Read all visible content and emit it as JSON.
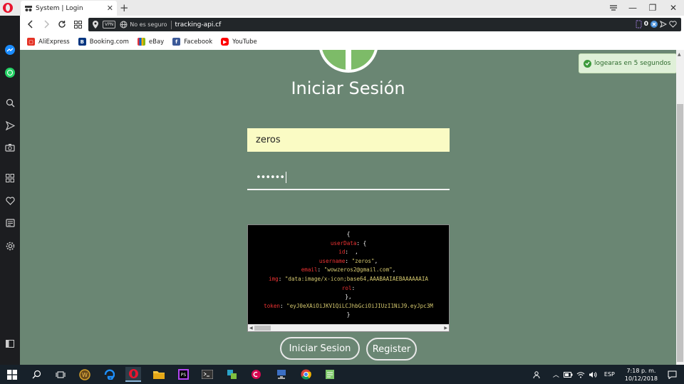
{
  "browser": {
    "tab_title": "System | Login",
    "new_tab": "+",
    "tab_close": "✕",
    "vpn_label": "VPN",
    "security_label": "No es seguro",
    "url": "tracking-api.cf",
    "adblock_count": "0",
    "window_minimize": "—",
    "window_restore": "❐",
    "window_close": "✕"
  },
  "bookmarks": [
    {
      "label": "AliExpress",
      "icon": "aliexpress-icon",
      "color": "#e43225"
    },
    {
      "label": "Booking.com",
      "icon": "booking-icon",
      "color": "#003580"
    },
    {
      "label": "eBay",
      "icon": "ebay-icon",
      "color": "#e53238"
    },
    {
      "label": "Facebook",
      "icon": "facebook-icon",
      "color": "#3b5998"
    },
    {
      "label": "YouTube",
      "icon": "youtube-icon",
      "color": "#ff0000"
    }
  ],
  "sidebar": [
    {
      "icon": "messenger-icon",
      "color": "#1a8cff"
    },
    {
      "icon": "whatsapp-icon",
      "color": "#25d366"
    },
    {
      "icon": "search-icon"
    },
    {
      "icon": "send-icon"
    },
    {
      "icon": "camera-icon"
    },
    {
      "icon": "grid-icon"
    },
    {
      "icon": "heart-icon"
    },
    {
      "icon": "news-icon"
    },
    {
      "icon": "settings-icon"
    },
    {
      "icon": "sidebar-toggle-icon"
    }
  ],
  "page": {
    "title": "Iniciar Sesión",
    "username_value": "zeros",
    "password_mask": "••••••",
    "login_button": "Iniciar Sesion",
    "register_button": "Register",
    "toast_text": "logearas en 5 segundos",
    "background_color": "#6a8673",
    "input_fill_color": "#fafbc4"
  },
  "code_lines": [
    [
      {
        "c": "p",
        "t": "{"
      }
    ],
    [
      {
        "c": "k",
        "t": "userData"
      },
      {
        "c": "p",
        "t": ": {"
      }
    ],
    [
      {
        "c": "k",
        "t": "id"
      },
      {
        "c": "p",
        "t": ":  ,"
      }
    ],
    [
      {
        "c": "k",
        "t": "username"
      },
      {
        "c": "p",
        "t": ": "
      },
      {
        "c": "s",
        "t": "\"zeros\""
      },
      {
        "c": "p",
        "t": ","
      }
    ],
    [
      {
        "c": "k",
        "t": "email"
      },
      {
        "c": "p",
        "t": ": "
      },
      {
        "c": "s",
        "t": "\"wowzeros2@gmail.com\""
      },
      {
        "c": "p",
        "t": ","
      }
    ],
    [
      {
        "c": "k",
        "t": "img"
      },
      {
        "c": "p",
        "t": ": "
      },
      {
        "c": "s",
        "t": "\"data:image/x-icon;base64,AAABAAIAEBAAAAAAIA"
      }
    ],
    [
      {
        "c": "k",
        "t": "rol"
      },
      {
        "c": "p",
        "t": ":"
      }
    ],
    [
      {
        "c": "p",
        "t": "},"
      }
    ],
    [
      {
        "c": "k",
        "t": "token"
      },
      {
        "c": "p",
        "t": ": "
      },
      {
        "c": "s",
        "t": "\"eyJ0eXAiOiJKV1QiLCJhbGciOiJIUzI1NiJ9.eyJpc3M"
      }
    ],
    [
      {
        "c": "p",
        "t": "}"
      }
    ]
  ],
  "taskbar": {
    "apps": [
      "start-icon",
      "cortana-search-icon",
      "task-view-icon",
      "world-of-warcraft-icon",
      "edge-icon",
      "opera-icon",
      "file-explorer-icon",
      "phpstorm-icon",
      "terminal-icon",
      "app-icon",
      "debian-icon",
      "network-app-icon",
      "chrome-icon",
      "notepad-icon"
    ],
    "language": "ESP",
    "time": "7:18 p. m.",
    "date": "10/12/2018"
  }
}
